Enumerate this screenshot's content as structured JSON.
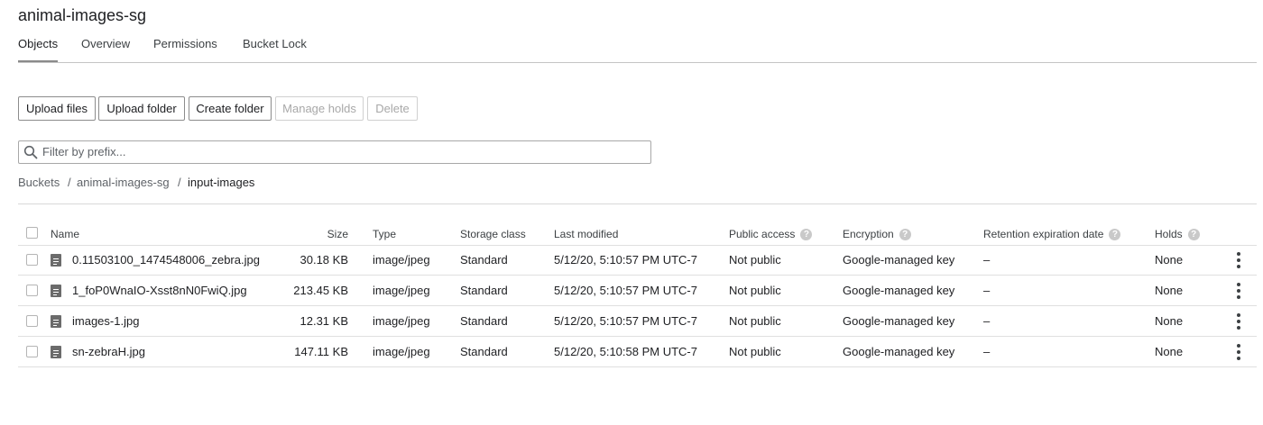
{
  "bucket_title": "animal-images-sg",
  "tabs": [
    {
      "label": "Objects",
      "active": true
    },
    {
      "label": "Overview",
      "active": false
    },
    {
      "label": "Permissions",
      "active": false
    },
    {
      "label": "Bucket Lock",
      "active": false
    }
  ],
  "toolbar": {
    "upload_files": "Upload files",
    "upload_folder": "Upload folder",
    "create_folder": "Create folder",
    "manage_holds": "Manage holds",
    "delete": "Delete"
  },
  "filter": {
    "placeholder": "Filter by prefix...",
    "icon": "search-icon"
  },
  "breadcrumb": [
    "Buckets",
    "/",
    "animal-images-sg",
    "/",
    "input-images"
  ],
  "columns": {
    "name": "Name",
    "size": "Size",
    "type": "Type",
    "storage_class": "Storage class",
    "last_modified": "Last modified",
    "public_access": "Public access",
    "encryption": "Encryption",
    "retention": "Retention expiration date",
    "holds": "Holds"
  },
  "rows": [
    {
      "name": "0.11503100_1474548006_zebra.jpg",
      "size": "30.18 KB",
      "type": "image/jpeg",
      "storage_class": "Standard",
      "last_modified": "5/12/20, 5:10:57 PM UTC-7",
      "public_access": "Not public",
      "encryption": "Google-managed key",
      "retention": "–",
      "holds": "None"
    },
    {
      "name": "1_foP0WnaIO-Xsst8nN0FwiQ.jpg",
      "size": "213.45 KB",
      "type": "image/jpeg",
      "storage_class": "Standard",
      "last_modified": "5/12/20, 5:10:57 PM UTC-7",
      "public_access": "Not public",
      "encryption": "Google-managed key",
      "retention": "–",
      "holds": "None"
    },
    {
      "name": "images-1.jpg",
      "size": "12.31 KB",
      "type": "image/jpeg",
      "storage_class": "Standard",
      "last_modified": "5/12/20, 5:10:57 PM UTC-7",
      "public_access": "Not public",
      "encryption": "Google-managed key",
      "retention": "–",
      "holds": "None"
    },
    {
      "name": "sn-zebraH.jpg",
      "size": "147.11 KB",
      "type": "image/jpeg",
      "storage_class": "Standard",
      "last_modified": "5/12/20, 5:10:58 PM UTC-7",
      "public_access": "Not public",
      "encryption": "Google-managed key",
      "retention": "–",
      "holds": "None"
    }
  ]
}
